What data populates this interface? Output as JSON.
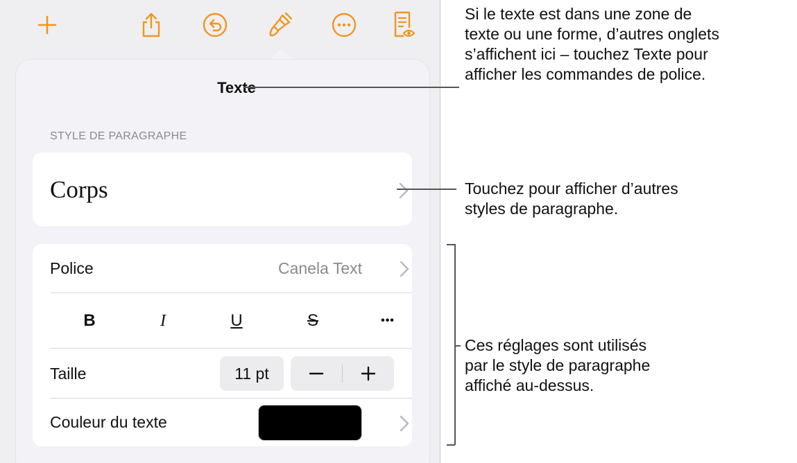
{
  "toolbar": {
    "items": [
      {
        "name": "add-icon"
      },
      {
        "name": "share-icon"
      },
      {
        "name": "undo-icon"
      },
      {
        "name": "format-brush-icon"
      },
      {
        "name": "more-icon"
      },
      {
        "name": "document-view-icon"
      }
    ],
    "accent_color": "#f0951f"
  },
  "popover": {
    "title": "Texte",
    "paragraph_section_label": "STYLE DE PARAGRAPHE",
    "paragraph_style": "Corps",
    "font_label": "Police",
    "font_value": "Canela Text",
    "format_buttons": {
      "bold": "B",
      "italic": "I",
      "underline": "U",
      "strikethrough": "S",
      "more": "•••"
    },
    "size_label": "Taille",
    "size_value": "11 pt",
    "color_label": "Couleur du texte",
    "text_color": "#000000"
  },
  "callouts": {
    "tabs_note": [
      "Si le texte est dans une zone de",
      "texte ou une forme, d’autres onglets",
      "s’affichent ici – touchez Texte pour",
      "afficher les commandes de police."
    ],
    "styles_note": [
      "Touchez pour afficher d’autres",
      "styles de paragraphe."
    ],
    "settings_note": [
      "Ces réglages sont utilisés",
      "par le style de paragraphe",
      "affiché au-dessus."
    ]
  }
}
